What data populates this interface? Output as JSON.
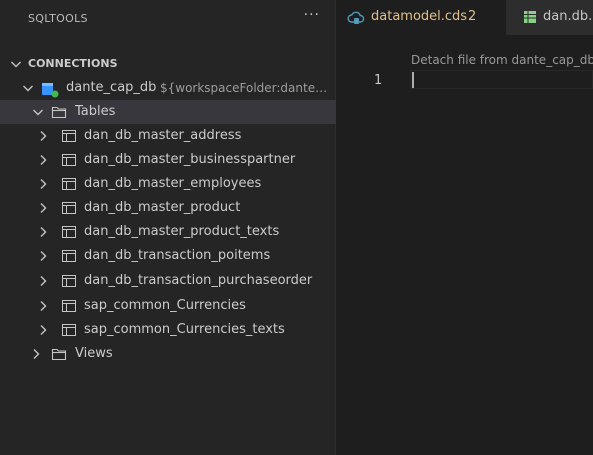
{
  "sidebar": {
    "title": "SQLTOOLS",
    "more_label": "···",
    "section_title": "CONNECTIONS",
    "connection": {
      "name": "dante_cap_db",
      "description": "${workspaceFolder:dante_..."
    },
    "tables_label": "Tables",
    "tables": [
      "dan_db_master_address",
      "dan_db_master_businesspartner",
      "dan_db_master_employees",
      "dan_db_master_product",
      "dan_db_master_product_texts",
      "dan_db_transaction_poitems",
      "dan_db_transaction_purchaseorder",
      "sap_common_Currencies",
      "sap_common_Currencies_texts"
    ],
    "views_label": "Views"
  },
  "editor": {
    "tabs": [
      {
        "label": "datamodel.cds",
        "badge": "2",
        "color": "#e2c08d",
        "icon": "cloud-db-icon"
      },
      {
        "label": "dan.db.m",
        "color": "#c5c5c5",
        "icon": "table-icon"
      }
    ],
    "codelens": "Detach file from dante_cap_db",
    "line_number": "1"
  },
  "colors": {
    "accent": "#e2c08d",
    "connected_dot": "#3fb950",
    "db_icon": "#3794ff",
    "tab_table_icon": "#89d185"
  }
}
